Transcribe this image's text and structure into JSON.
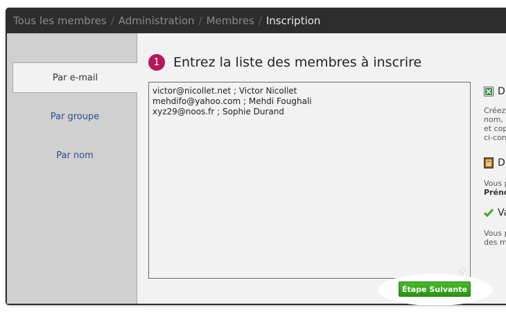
{
  "breadcrumb": {
    "items": [
      "Tous les membres",
      "Administration",
      "Membres"
    ],
    "current": "Inscription",
    "separator": "/"
  },
  "sidebar": {
    "tabs": [
      {
        "label": "Par e-mail",
        "active": true
      },
      {
        "label": "Par groupe",
        "active": false
      },
      {
        "label": "Par nom",
        "active": false
      }
    ]
  },
  "step": {
    "number": "1",
    "title": "Entrez la liste des membres à inscrire"
  },
  "members_input": {
    "value": "victor@nicollet.net ; Victor Nicollet\nmehdifo@yahoo.com ; Mehdi Foughali\nxyz29@noos.fr ; Sophie Durand"
  },
  "next_button": {
    "label": "Étape Suivante"
  },
  "help": {
    "excel": {
      "title": "D",
      "text": "Créez\nnom, \net cop\nci-con"
    },
    "book": {
      "title": "D",
      "text": "Vous p",
      "bold": "Préno"
    },
    "check": {
      "title": "Va",
      "text": "Vous p\ndes m"
    }
  },
  "colors": {
    "accent": "#b5175b",
    "button_green": "#3aa81f",
    "link_blue": "#2a4c8c",
    "topbar": "#2d2d2d"
  }
}
